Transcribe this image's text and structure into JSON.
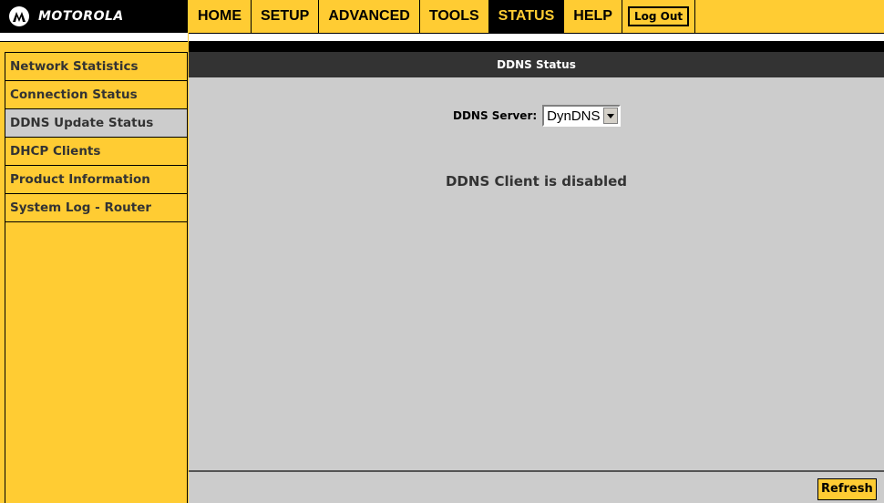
{
  "brand": {
    "name": "MOTOROLA",
    "logo_icon": "motorola-emblem-icon"
  },
  "top_nav": {
    "tabs": [
      {
        "label": "HOME",
        "active": false
      },
      {
        "label": "SETUP",
        "active": false
      },
      {
        "label": "ADVANCED",
        "active": false
      },
      {
        "label": "TOOLS",
        "active": false
      },
      {
        "label": "STATUS",
        "active": true
      },
      {
        "label": "HELP",
        "active": false
      }
    ],
    "logout_label": "Log Out"
  },
  "sidebar": {
    "items": [
      {
        "label": "Network Statistics",
        "active": false
      },
      {
        "label": "Connection Status",
        "active": false
      },
      {
        "label": "DDNS Update Status",
        "active": true
      },
      {
        "label": "DHCP Clients",
        "active": false
      },
      {
        "label": "Product Information",
        "active": false
      },
      {
        "label": "System Log - Router",
        "active": false
      }
    ]
  },
  "main": {
    "section_title": "DDNS Status",
    "server_label": "DDNS Server:",
    "server_value": "DynDNS",
    "status_message": "DDNS Client is disabled",
    "refresh_label": "Refresh"
  },
  "colors": {
    "accent": "#ffcc33",
    "content_bg": "#cccccc",
    "header_bar": "#333333"
  }
}
